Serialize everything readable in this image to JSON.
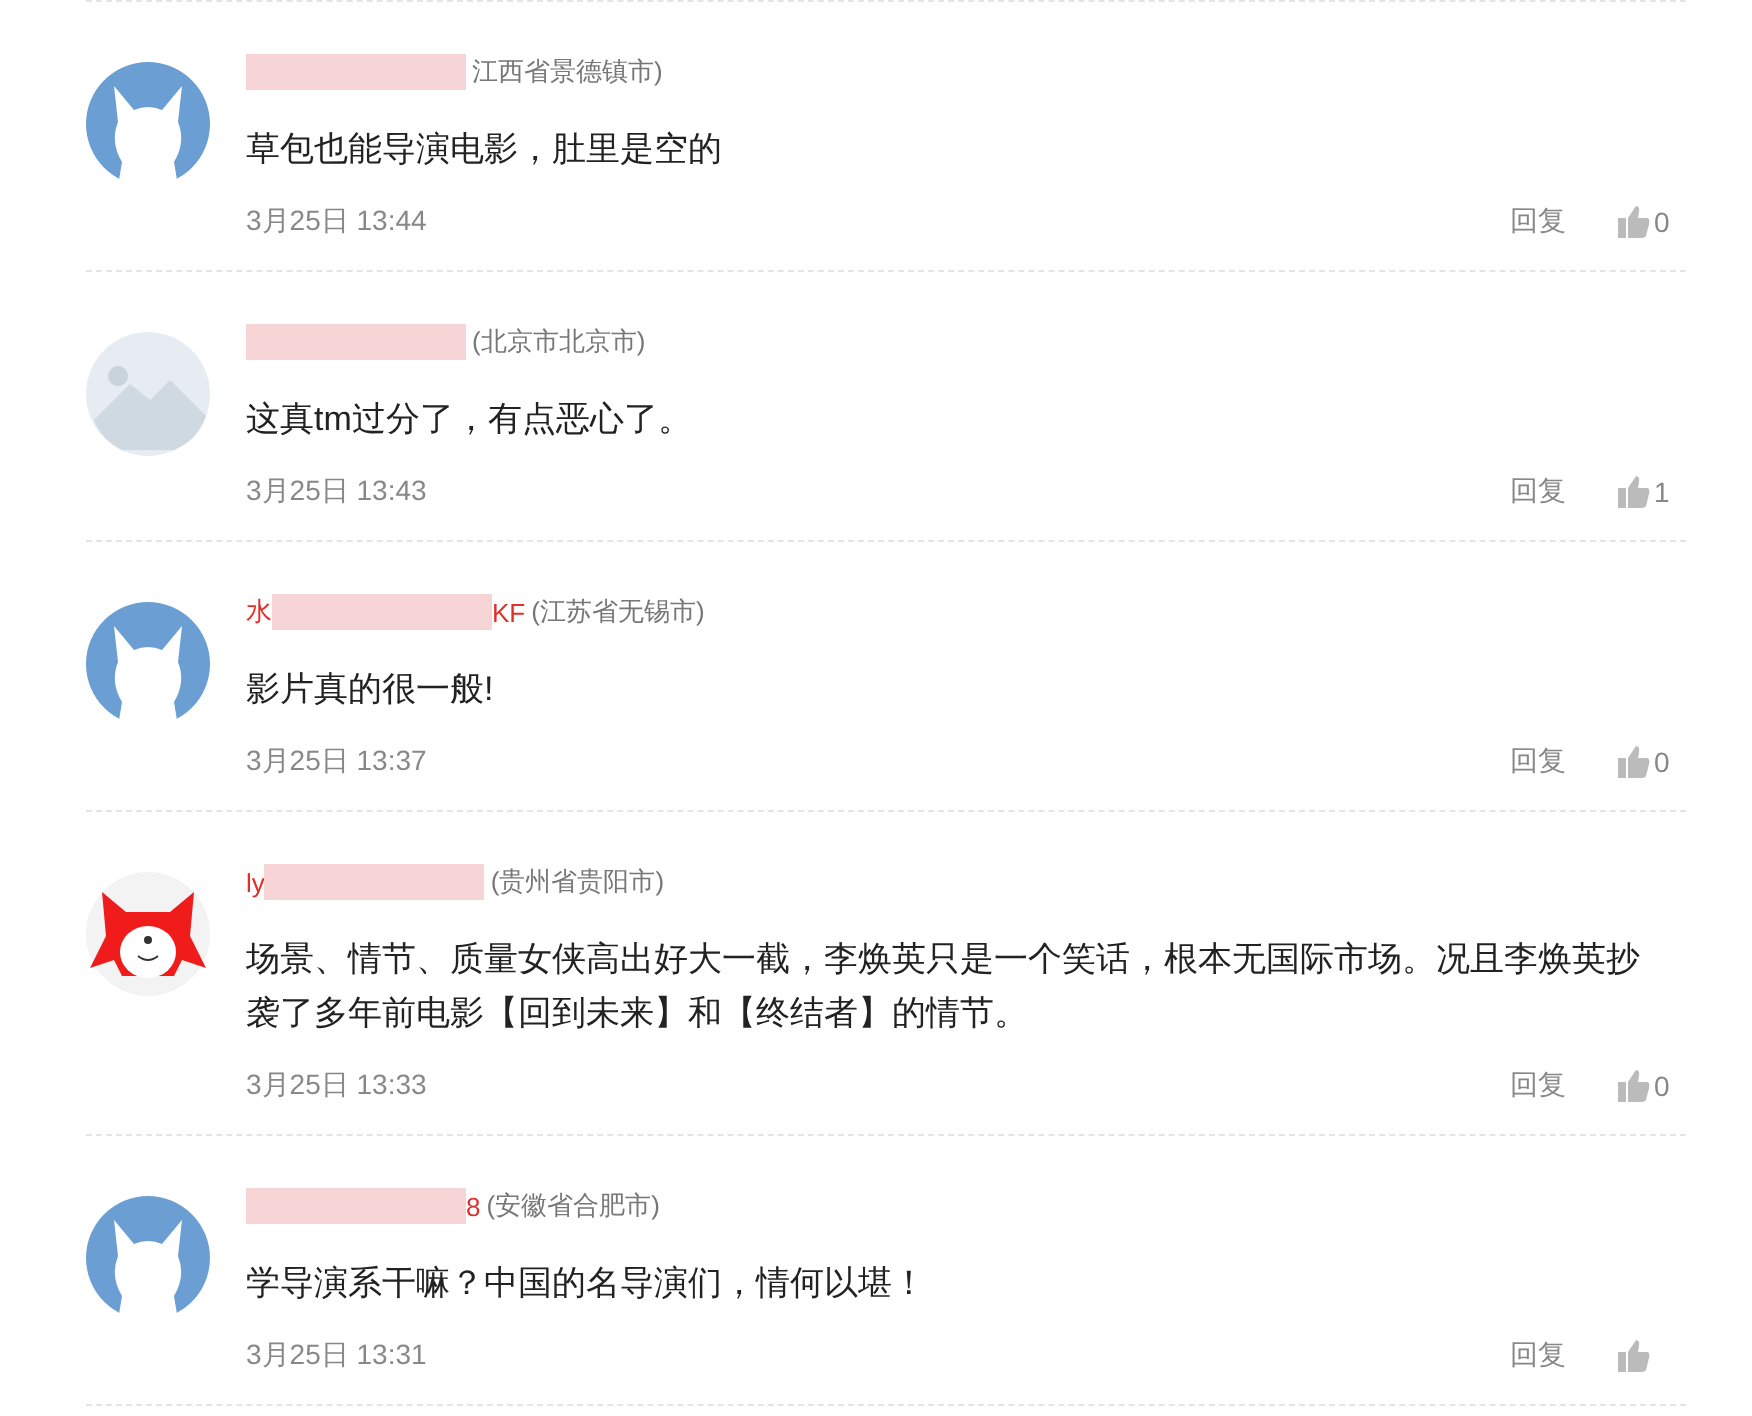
{
  "comments": [
    {
      "kind": "default",
      "redacted": true,
      "location": "江西省景德镇市)",
      "text": "草包也能导演电影，肚里是空的",
      "time": "3月25日 13:44",
      "reply": "回复",
      "likes": "0"
    },
    {
      "kind": "landscape",
      "redacted": true,
      "location": "(北京市北京市)",
      "text": "这真tm过分了，有点恶心了。",
      "time": "3月25日 13:43",
      "reply": "回复",
      "likes": "1"
    },
    {
      "kind": "default",
      "name_start": "水",
      "name_end": "KF",
      "redacted": true,
      "location": "(江苏省无锡市)",
      "text": "影片真的很一般!",
      "time": "3月25日 13:37",
      "reply": "回复",
      "likes": "0"
    },
    {
      "kind": "fox",
      "name_start": "ly",
      "redacted": true,
      "location": "(贵州省贵阳市)",
      "text": "场景、情节、质量女侠高出好大一截，李焕英只是一个笑话，根本无国际市场。况且李焕英抄袭了多年前电影【回到未来】和【终结者】的情节。",
      "time": "3月25日 13:33",
      "reply": "回复",
      "likes": "0"
    },
    {
      "kind": "default",
      "name_end": "8",
      "redacted": true,
      "location": "(安徽省合肥市)",
      "text": "学导演系干嘛？中国的名导演们，情何以堪！",
      "time": "3月25日 13:31",
      "reply": "回复"
    }
  ]
}
